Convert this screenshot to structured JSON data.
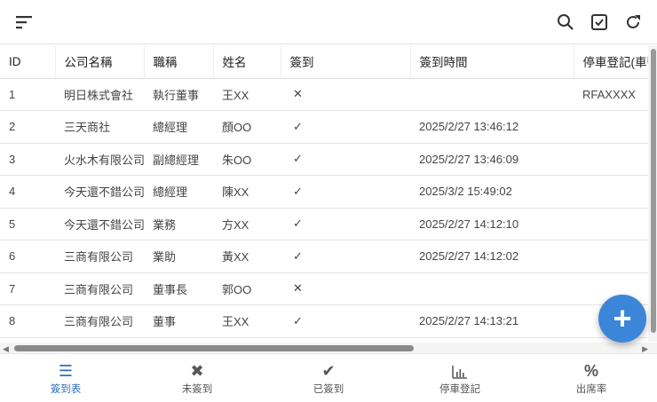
{
  "columns": [
    "ID",
    "公司名稱",
    "職稱",
    "姓名",
    "簽到",
    "簽到時間",
    "停車登記(車號"
  ],
  "rows": [
    [
      "1",
      "明日株式會社",
      "執行董事",
      "王XX",
      "✕",
      "",
      "RFAXXXX"
    ],
    [
      "2",
      "三天商社",
      "總經理",
      "顏OO",
      "✓",
      "2025/2/27 13:46:12",
      ""
    ],
    [
      "3",
      "火水木有限公司",
      "副總經理",
      "朱OO",
      "✓",
      "2025/2/27 13:46:09",
      ""
    ],
    [
      "4",
      "今天還不錯公司",
      "總經理",
      "陳XX",
      "✓",
      "2025/3/2 15:49:02",
      ""
    ],
    [
      "5",
      "今天還不錯公司",
      "業務",
      "方XX",
      "✓",
      "2025/2/27 14:12:10",
      ""
    ],
    [
      "6",
      "三商有限公司",
      "業助",
      "黃XX",
      "✓",
      "2025/2/27 14:12:02",
      ""
    ],
    [
      "7",
      "三商有限公司",
      "董事長",
      "郭OO",
      "✕",
      "",
      ""
    ],
    [
      "8",
      "三商有限公司",
      "董事",
      "王XX",
      "✓",
      "2025/2/27 14:13:21",
      ""
    ]
  ],
  "fab": "+",
  "nav": [
    {
      "label": "簽到表",
      "icon": "list-icon",
      "glyph": "☰"
    },
    {
      "label": "未簽到",
      "icon": "x-icon",
      "glyph": "✖"
    },
    {
      "label": "已簽到",
      "icon": "check-icon",
      "glyph": "✔"
    },
    {
      "label": "停車登記",
      "icon": "bar-chart-icon",
      "glyph": "📊"
    },
    {
      "label": "出席率",
      "icon": "percent-icon",
      "glyph": "%"
    }
  ]
}
